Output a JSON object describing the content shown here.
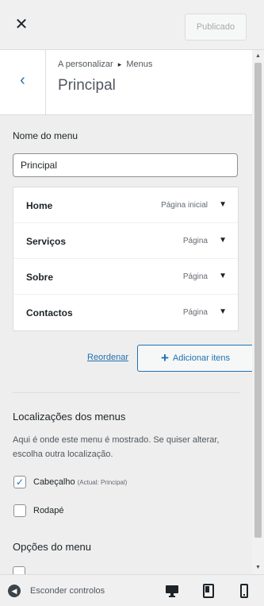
{
  "header": {
    "close_symbol": "✕",
    "publish_label": "Publicado"
  },
  "panel": {
    "back_symbol": "‹",
    "breadcrumb_prefix": "A personalizar",
    "breadcrumb_arrow": "▸",
    "breadcrumb_section": "Menus",
    "title": "Principal"
  },
  "menu_name": {
    "label": "Nome do menu",
    "value": "Principal"
  },
  "menu_items": [
    {
      "title": "Home",
      "type": "Página inicial"
    },
    {
      "title": "Serviços",
      "type": "Página"
    },
    {
      "title": "Sobre",
      "type": "Página"
    },
    {
      "title": "Contactos",
      "type": "Página"
    }
  ],
  "actions": {
    "reorder_label": "Reordenar",
    "add_items_label": "Adicionar itens"
  },
  "locations": {
    "heading": "Localizações dos menus",
    "description": "Aqui é onde este menu é mostrado. Se quiser alterar, escolha outra localização.",
    "options": [
      {
        "label": "Cabeçalho",
        "note": "(Actual: Principal)",
        "checked": true
      },
      {
        "label": "Rodapé",
        "note": "",
        "checked": false
      }
    ]
  },
  "menu_options": {
    "heading": "Opções do menu"
  },
  "footer": {
    "collapse_label": "Esconder controlos"
  },
  "icons": {
    "close": "close-icon",
    "back": "chevron-left-icon",
    "item_toggle": "caret-down-icon",
    "add": "plus-icon",
    "checkbox_checked": "checkmark-icon",
    "collapse": "collapse-circle-icon",
    "desktop": "desktop-icon",
    "tablet": "tablet-icon",
    "mobile": "mobile-icon"
  },
  "colors": {
    "accent": "#2271b1",
    "text": "#1d2327",
    "muted": "#50575e",
    "panel_bg": "#eeeeee"
  }
}
